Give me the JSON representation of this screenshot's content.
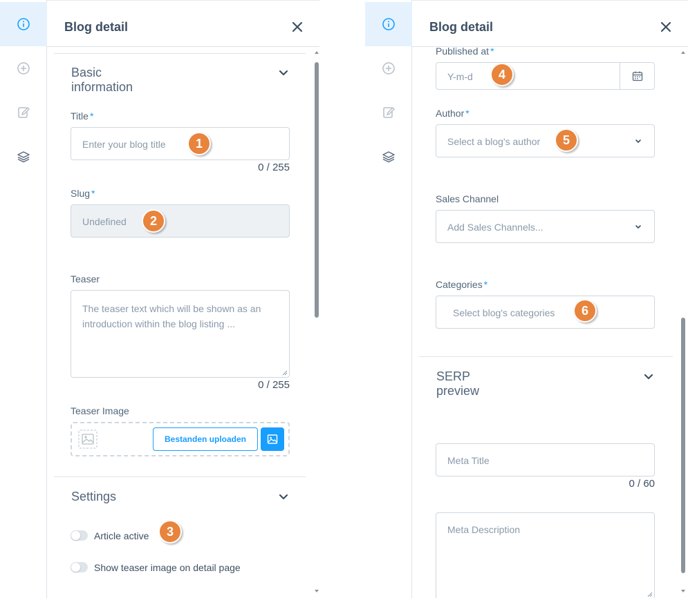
{
  "left_panel": {
    "header": {
      "title": "Blog detail"
    },
    "basic_section": {
      "title_line1": "Basic",
      "title_line2": "information"
    },
    "title_field": {
      "label": "Title",
      "required": "*",
      "placeholder": "Enter your blog title",
      "counter": "0 / 255",
      "badge": "1"
    },
    "slug_field": {
      "label": "Slug",
      "required": "*",
      "value": "Undefined",
      "badge": "2"
    },
    "teaser_field": {
      "label": "Teaser",
      "placeholder_line1": "The teaser text which will be shown as an",
      "placeholder_line2": "introduction within the blog listing ...",
      "counter": "0 / 255"
    },
    "teaser_image": {
      "label": "Teaser Image",
      "upload_label": "Bestanden uploaden"
    },
    "settings_section": {
      "title": "Settings"
    },
    "toggles": [
      {
        "label": "Article active",
        "badge": "3"
      },
      {
        "label": "Show teaser image on detail page"
      }
    ]
  },
  "right_panel": {
    "header": {
      "title": "Blog detail"
    },
    "published_field": {
      "label": "Published at",
      "required": "*",
      "placeholder": "Y-m-d",
      "badge": "4"
    },
    "author_field": {
      "label": "Author",
      "required": "*",
      "placeholder": "Select a blog's author",
      "badge": "5"
    },
    "sales_channel_field": {
      "label": "Sales Channel",
      "placeholder": "Add Sales Channels..."
    },
    "categories_field": {
      "label": "Categories",
      "required": "*",
      "placeholder": "Select blog's categories",
      "badge": "6"
    },
    "serp_section": {
      "title_line1": "SERP",
      "title_line2": "preview"
    },
    "meta_title_field": {
      "placeholder": "Meta Title",
      "counter": "0 / 60"
    },
    "meta_description_field": {
      "placeholder": "Meta Description"
    }
  },
  "colors": {
    "accent": "#189eff",
    "badge": "#e8843c",
    "rail_active": "#e5f2fd",
    "border": "#cfd7df",
    "text": "#3d4f63"
  },
  "icons": {
    "rail": [
      "info-icon",
      "plus-circle-icon",
      "edit-icon",
      "layers-icon"
    ],
    "close": "close-icon",
    "chevron": "chevron-down-icon",
    "calendar": "calendar-icon",
    "image": "image-icon"
  }
}
